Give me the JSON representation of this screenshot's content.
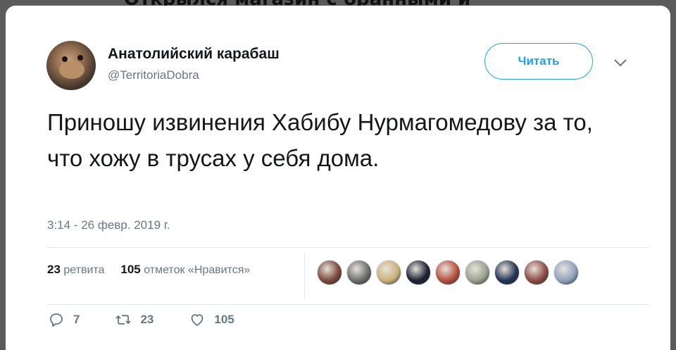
{
  "background": {
    "partial_heading": "Открылся магазин с бранными и"
  },
  "tweet": {
    "author_name": "Анатолийский карабаш",
    "author_handle": "@TerritoriaDobra",
    "follow_label": "Читать",
    "text": "Приношу извинения Хабибу Нурмагомедову за то, что хожу в трусах у себя дома.",
    "timestamp": "3:14 - 26 февр. 2019 г.",
    "retweets_count": "23",
    "retweets_label": "ретвита",
    "likes_count": "105",
    "likes_label": "отметок «Нравится»",
    "likers": [
      {
        "icon": "avatar-woman-dark-hair",
        "color": "#7b4a3a"
      },
      {
        "icon": "avatar-black-white",
        "color": "#6e6e6e"
      },
      {
        "icon": "avatar-plate",
        "color": "#c9b27a"
      },
      {
        "icon": "avatar-valknut",
        "color": "#1d2333"
      },
      {
        "icon": "avatar-woman-red",
        "color": "#b4513f"
      },
      {
        "icon": "avatar-stone",
        "color": "#9aa08f"
      },
      {
        "icon": "avatar-earth-night",
        "color": "#233654"
      },
      {
        "icon": "avatar-woman",
        "color": "#8b4c44"
      },
      {
        "icon": "avatar-car",
        "color": "#8fa2bd"
      }
    ],
    "actions": {
      "reply_count": "7",
      "retweet_count": "23",
      "like_count": "105"
    }
  },
  "colors": {
    "accent": "#1da1f2",
    "muted": "#657786",
    "text": "#14171a",
    "divider": "#e1e8ed"
  }
}
